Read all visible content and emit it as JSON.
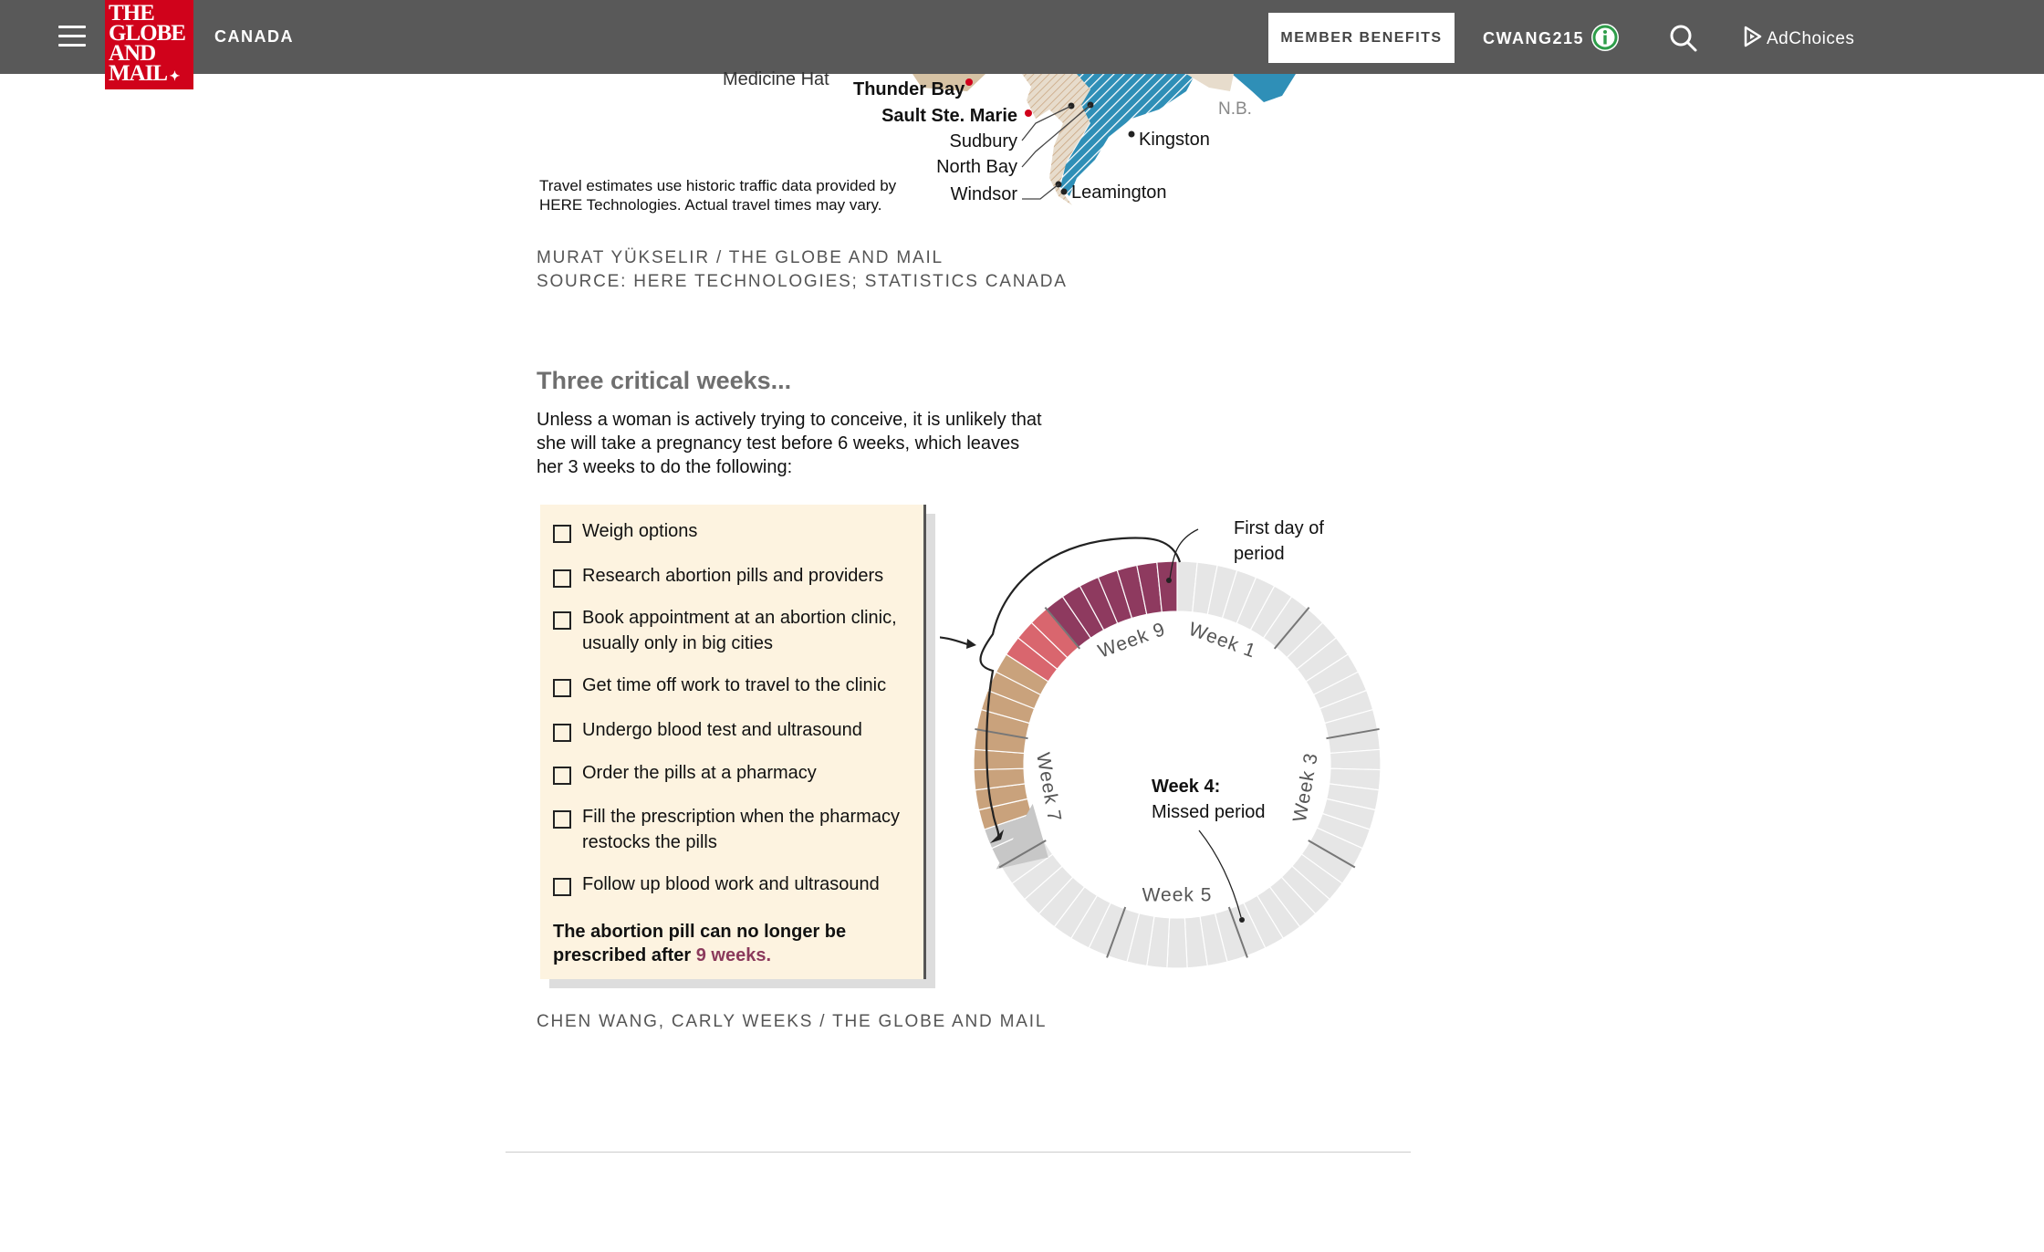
{
  "nav": {
    "section": "CANADA",
    "logo_lines": [
      "THE",
      "GLOBE",
      "AND",
      "MAIL"
    ],
    "member_benefits": "MEMBER BENEFITS",
    "username": "CWANG215",
    "adchoices": "AdChoices",
    "icons": [
      "hamburger-menu-icon",
      "info-icon",
      "search-icon",
      "adchoices-icon"
    ]
  },
  "map": {
    "labels": {
      "medicine_hat": "Medicine Hat",
      "thunder_bay": "Thunder Bay",
      "sault_ste_marie": "Sault Ste. Marie",
      "sudbury": "Sudbury",
      "north_bay": "North Bay",
      "windsor": "Windsor",
      "kingston": "Kingston",
      "leamington": "Leamington",
      "nb": "N.B."
    },
    "note": "Travel estimates use historic traffic data provided by HERE Technologies. Actual travel times may vary.",
    "credit_line1": "MURAT YÜKSELIR / THE GLOBE AND MAIL",
    "credit_line2": "SOURCE: HERE TECHNOLOGIES; STATISTICS CANADA"
  },
  "graphic": {
    "heading": "Three critical weeks...",
    "intro": "Unless a woman is actively trying to conceive, it is unlikely that she will take a pregnancy test before 6 weeks, which leaves her 3 weeks to do the following:",
    "checklist": [
      "Weigh options",
      "Research abortion pills and providers",
      "Book appointment at an abortion clinic, usually only in big cities",
      "Get time off work to travel to the clinic",
      "Undergo blood test and ultrasound",
      "Order the pills at a pharmacy",
      "Fill the prescription when the pharmacy restocks the pills",
      "Follow up blood work and ultrasound"
    ],
    "final_text": "The abortion pill can no longer be prescribed after ",
    "final_highlight": "9 weeks.",
    "ring": {
      "first_day": "First day of period",
      "first_day_line1": "First day of",
      "first_day_line2": "period",
      "week_labels": [
        "Week 1",
        "Week 3",
        "Week 5",
        "Week 7",
        "Week 9"
      ],
      "week4_title": "Week 4:",
      "week4_sub": "Missed period",
      "total_days": 63,
      "colors": {
        "track": "#e6e6e6",
        "weeks_7_8": "#c9a27c",
        "week_8": "#d9666e",
        "week_9": "#8e3a5f",
        "pointer": "#c7c7c7"
      }
    },
    "credit": "CHEN WANG, CARLY WEEKS / THE GLOBE AND MAIL"
  }
}
